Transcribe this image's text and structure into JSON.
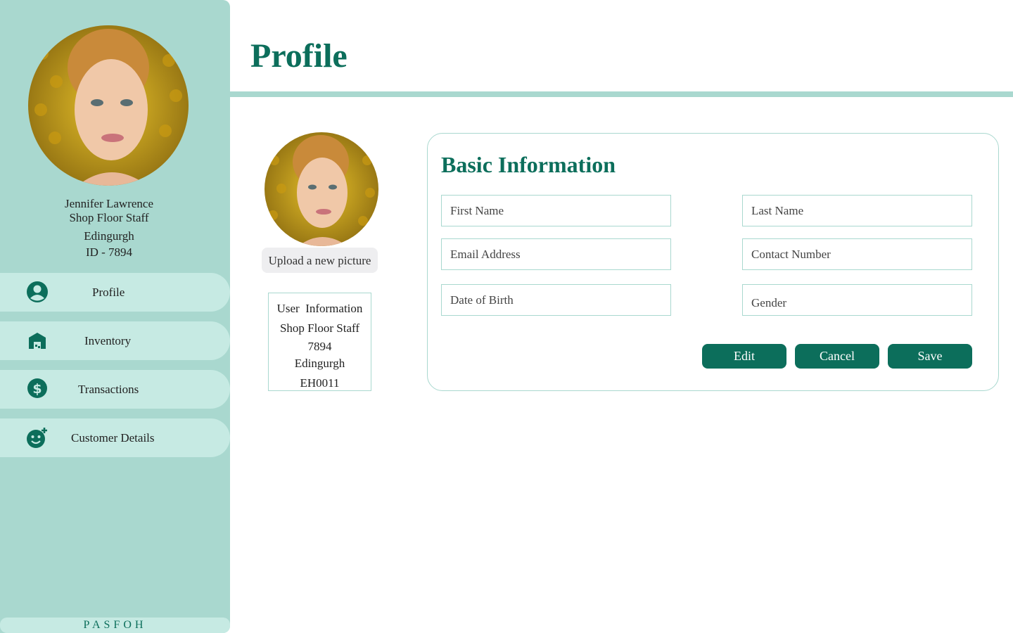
{
  "sidebar": {
    "user": {
      "name": "Jennifer Lawrence",
      "role": "Shop Floor Staff",
      "location": "Edingurgh",
      "id_line": "ID - 7894"
    },
    "nav": [
      {
        "label": "Profile",
        "icon": "user-circle-icon"
      },
      {
        "label": "Inventory",
        "icon": "warehouse-icon"
      },
      {
        "label": "Transactions",
        "icon": "dollar-circle-icon"
      },
      {
        "label": "Customer Details",
        "icon": "add-customer-icon"
      }
    ],
    "brand": "PASFOH"
  },
  "header": {
    "title": "Profile"
  },
  "profile_panel": {
    "upload_label": "Upload a new picture",
    "user_info": {
      "heading": "User  Information",
      "role": "Shop Floor Staff",
      "id": "7894",
      "location": "Edingurgh",
      "code": "EH0011"
    }
  },
  "basic_info": {
    "title": "Basic Information",
    "fields": {
      "first_name": {
        "placeholder": "First Name",
        "value": ""
      },
      "last_name": {
        "placeholder": "Last Name",
        "value": ""
      },
      "email": {
        "placeholder": "Email Address",
        "value": ""
      },
      "contact": {
        "placeholder": "Contact Number",
        "value": ""
      },
      "dob": {
        "placeholder": "Date of Birth",
        "value": ""
      },
      "gender": {
        "placeholder": "Gender",
        "value": ""
      }
    },
    "buttons": {
      "edit": "Edit",
      "cancel": "Cancel",
      "save": "Save"
    }
  },
  "colors": {
    "accent": "#0c6e5b",
    "sidebar_bg": "#a9d8cf",
    "nav_item_bg": "#c6eae3"
  }
}
